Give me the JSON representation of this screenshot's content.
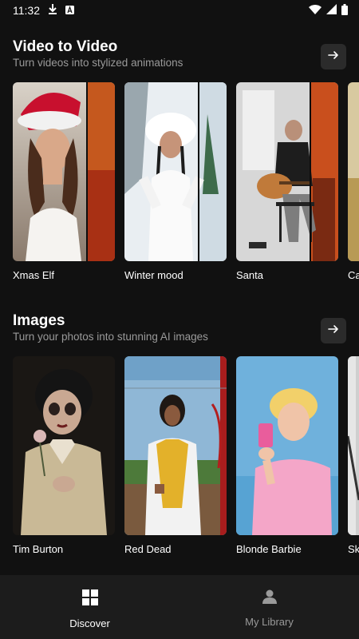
{
  "status": {
    "time": "11:32"
  },
  "video_section": {
    "title": "Video to Video",
    "subtitle": "Turn videos into stylized animations",
    "cards": [
      {
        "label": "Xmas Elf"
      },
      {
        "label": "Winter mood"
      },
      {
        "label": "Santa"
      },
      {
        "label": "Ca"
      }
    ]
  },
  "images_section": {
    "title": "Images",
    "subtitle": "Turn your photos into stunning AI images",
    "cards": [
      {
        "label": "Tim Burton"
      },
      {
        "label": "Red Dead"
      },
      {
        "label": "Blonde Barbie"
      },
      {
        "label": "Sk"
      }
    ]
  },
  "nav": {
    "discover": "Discover",
    "library": "My Library"
  }
}
